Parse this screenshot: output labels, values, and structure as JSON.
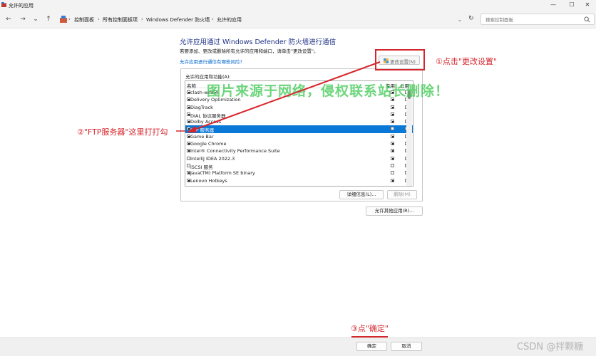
{
  "window": {
    "title": "允许的应用",
    "min_glyph": "—",
    "max_glyph": "☐",
    "close_glyph": "✕"
  },
  "nav": {
    "back_glyph": "←",
    "forward_glyph": "→",
    "recent_glyph": "⌄",
    "up_glyph": "↑",
    "refresh_glyph": "↻",
    "dropdown_glyph": "⌄"
  },
  "breadcrumb": [
    "控制面板",
    "所有控制面板项",
    "Windows Defender 防火墙",
    "允许的应用"
  ],
  "breadcrumb_sep": "›",
  "search": {
    "placeholder": "搜索控制面板"
  },
  "main": {
    "heading": "允许应用通过 Windows Defender 防火墙进行通信",
    "subtext": "若要添加、更改或删除所有允许的应用和端口，请单击\"更改设置\"。",
    "risk_link": "允许应用进行通信有哪些风险?",
    "change_settings": "更改设置(N)",
    "apps_label": "允许的应用和功能(A):",
    "columns": {
      "name": "名称",
      "private": "专用",
      "public": "公用"
    },
    "apps": [
      {
        "name": "clash-win64",
        "enabled": true,
        "private": true,
        "public": true
      },
      {
        "name": "Delivery Optimization",
        "enabled": true,
        "private": true,
        "public": true
      },
      {
        "name": "DiagTrack",
        "enabled": true,
        "private": true,
        "public": true
      },
      {
        "name": "DIAL 协议服务器",
        "enabled": true,
        "private": true,
        "public": false
      },
      {
        "name": "Dolby Access",
        "enabled": true,
        "private": true,
        "public": true
      },
      {
        "name": "FTP 服务器",
        "enabled": true,
        "private": false,
        "public": true,
        "selected": true
      },
      {
        "name": "Game Bar",
        "enabled": true,
        "private": true,
        "public": true
      },
      {
        "name": "Google Chrome",
        "enabled": true,
        "private": true,
        "public": true
      },
      {
        "name": "Intel® Connectivity Performance Suite",
        "enabled": true,
        "private": true,
        "public": true
      },
      {
        "name": "IntelliJ IDEA 2022.3",
        "enabled": false,
        "private": true,
        "public": true
      },
      {
        "name": "iSCSI 服务",
        "enabled": false,
        "private": false,
        "public": false
      },
      {
        "name": "Java(TM) Platform SE binary",
        "enabled": true,
        "private": false,
        "public": true
      },
      {
        "name": "Lenovo Hotkeys",
        "enabled": true,
        "private": true,
        "public": true
      }
    ],
    "details_button": "详细信息(L)...",
    "remove_button": "删除(M)",
    "allow_other_button": "允许其他应用(R)..."
  },
  "footer": {
    "ok": "确定",
    "cancel": "取消"
  },
  "annotations": {
    "step1": "①点击\"更改设置\"",
    "step2": "②\"FTP服务器\"这里打打勾",
    "step3": "③点\"确定\"",
    "color": "#d6262d"
  },
  "watermark": "图片来源于网络，侵权联系站长删除！",
  "credit": "CSDN @拌颗糖"
}
